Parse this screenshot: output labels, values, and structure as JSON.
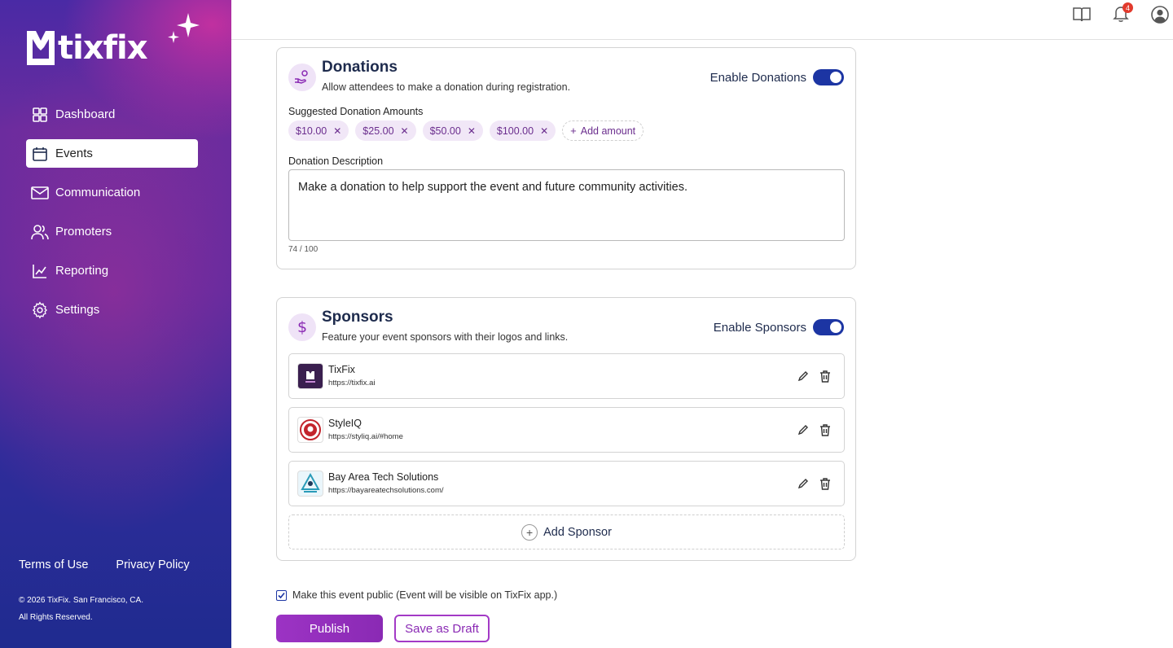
{
  "brand": {
    "name": "tixfix"
  },
  "sidebar": {
    "items": [
      {
        "label": "Dashboard",
        "icon": "dashboard-icon",
        "active": false
      },
      {
        "label": "Events",
        "icon": "calendar-icon",
        "active": true
      },
      {
        "label": "Communication",
        "icon": "mail-icon",
        "active": false
      },
      {
        "label": "Promoters",
        "icon": "users-icon",
        "active": false
      },
      {
        "label": "Reporting",
        "icon": "chart-icon",
        "active": false
      },
      {
        "label": "Settings",
        "icon": "gear-icon",
        "active": false
      }
    ],
    "footer": {
      "terms": "Terms of Use",
      "privacy": "Privacy Policy",
      "copyright_line1": "© 2026 TixFix. San Francisco, CA.",
      "copyright_line2": "All Rights Reserved."
    }
  },
  "topbar": {
    "icons": [
      "book-icon",
      "bell-icon",
      "profile-icon"
    ],
    "notification_count": "4"
  },
  "donations": {
    "title": "Donations",
    "subtitle": "Allow attendees to make a donation during registration.",
    "toggle_label": "Enable Donations",
    "enabled": true,
    "amounts_label": "Suggested Donation Amounts",
    "amounts": [
      "$10.00",
      "$25.00",
      "$50.00",
      "$100.00"
    ],
    "add_amount_label": "Add amount",
    "description_label": "Donation Description",
    "description_value": "Make a donation to help support the event and future community activities.",
    "counter": "74 / 100"
  },
  "sponsors": {
    "title": "Sponsors",
    "subtitle": "Feature your event sponsors with their logos and links.",
    "toggle_label": "Enable Sponsors",
    "enabled": true,
    "items": [
      {
        "name": "TixFix",
        "url": "https://tixfix.ai"
      },
      {
        "name": "StyleIQ",
        "url": "https://styliq.ai/#home"
      },
      {
        "name": "Bay Area Tech Solutions",
        "url": "https://bayareatechsolutions.com/"
      }
    ],
    "add_label": "Add Sponsor"
  },
  "public_checkbox": {
    "label": "Make this event public (Event will be visible on TixFix app.)",
    "checked": true
  },
  "actions": {
    "publish": "Publish",
    "draft": "Save as Draft"
  },
  "colors": {
    "accent": "#8a2ab4",
    "toggle": "#1c35a3",
    "chip_bg": "#f1e7f7"
  }
}
